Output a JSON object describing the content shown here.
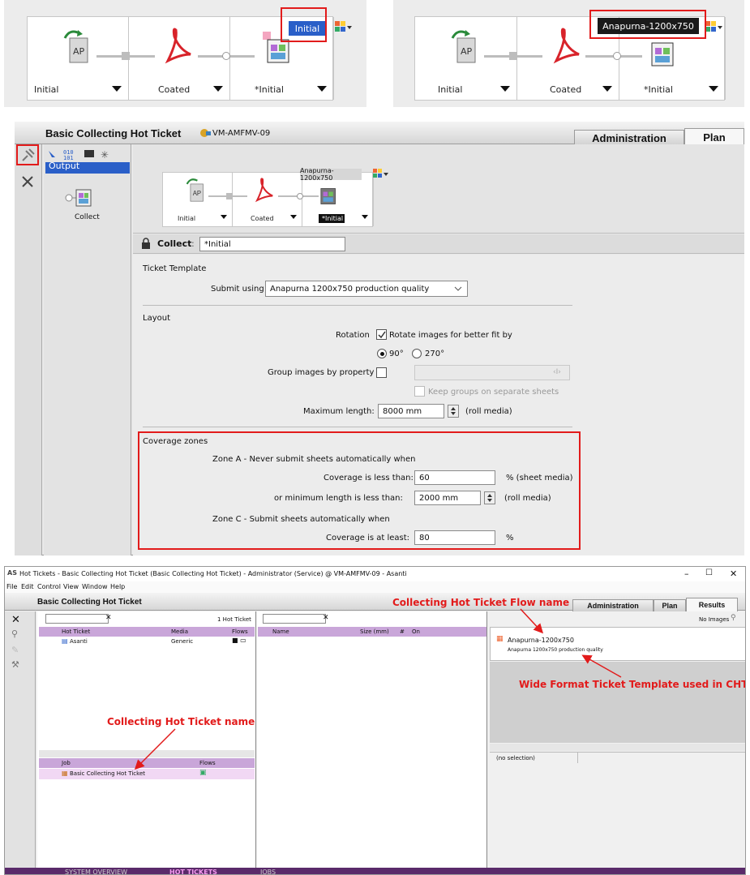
{
  "top_flows": [
    {
      "stage1": "Initial",
      "stage2": "Coated",
      "stage3": "*Initial",
      "selected_label": "Initial"
    },
    {
      "stage1": "Initial",
      "stage2": "Coated",
      "stage3": "*Initial",
      "selected_label": "Anapurna-1200x750"
    }
  ],
  "middle": {
    "title": "Basic Collecting Hot Ticket",
    "server": "VM-AMFMV-09",
    "tabs": [
      "Administration",
      "Plan"
    ],
    "output_label": "Output",
    "collect_label": "Collect",
    "flow": {
      "stage1": "Initial",
      "stage2": "Coated",
      "stage3": "*Initial",
      "flow_name": "Anapurna-1200x750"
    },
    "collect_field_label": "Collect",
    "collect_field_sep": ":",
    "collect_value": "*Initial",
    "ticket_template_label": "Ticket Template",
    "submit_using_label": "Submit using",
    "submit_using_value": "Anapurna 1200x750 production quality",
    "layout_label": "Layout",
    "rotation_label": "Rotation",
    "rotate_check_label": "Rotate images for better fit by",
    "radio_90": "90°",
    "radio_270": "270°",
    "group_label": "Group images by property",
    "group_btn": "‹I›",
    "keep_groups_label": "Keep groups on separate sheets",
    "max_length_label": "Maximum length:",
    "max_length_value": "8000 mm",
    "roll_media": "(roll media)",
    "coverage_label": "Coverage zones",
    "zone_a_label": "Zone A - Never submit sheets automatically when",
    "coverage_less_label": "Coverage is less than:",
    "coverage_less_value": "60",
    "sheet_media": "% (sheet media)",
    "min_length_label": "or minimum length is less than:",
    "min_length_value": "2000 mm",
    "roll_media2": "(roll media)",
    "zone_c_label": "Zone C - Submit sheets automatically when",
    "coverage_least_label": "Coverage is at least:",
    "coverage_least_value": "80",
    "percent": "%"
  },
  "bottom": {
    "window_title": "Hot Tickets - Basic Collecting Hot Ticket (Basic Collecting Hot Ticket) - Administrator (Service) @ VM-AMFMV-09 - Asanti",
    "menu": [
      "File",
      "Edit",
      "Control",
      "View",
      "Window",
      "Help"
    ],
    "title": "Basic Collecting Hot Ticket",
    "tabs": [
      "Administration",
      "Plan",
      "Results"
    ],
    "hot_ticket_count": "1 Hot Ticket",
    "col_hot_ticket": "Hot Ticket",
    "col_media": "Media",
    "col_flows": "Flows",
    "row_name": "Asanti",
    "row_media": "Generic",
    "col_job": "Job",
    "col_job_flows": "Flows",
    "job_row": "Basic Collecting Hot Ticket",
    "col_name": "Name",
    "col_size": "Size (mm)",
    "col_hash": "#",
    "col_on": "On",
    "no_images": "No Images",
    "flow_name": "Anapurna-1200x750",
    "flow_template": "Anapurna 1200x750 production quality",
    "no_selection": "(no selection)",
    "status_tabs": [
      "SYSTEM OVERVIEW",
      "HOT TICKETS",
      "JOBS"
    ],
    "annotation_flow": "Collecting Hot Ticket Flow name",
    "annotation_template": "Wide Format Ticket Template used in CHT",
    "annotation_name": "Collecting Hot Ticket name"
  }
}
